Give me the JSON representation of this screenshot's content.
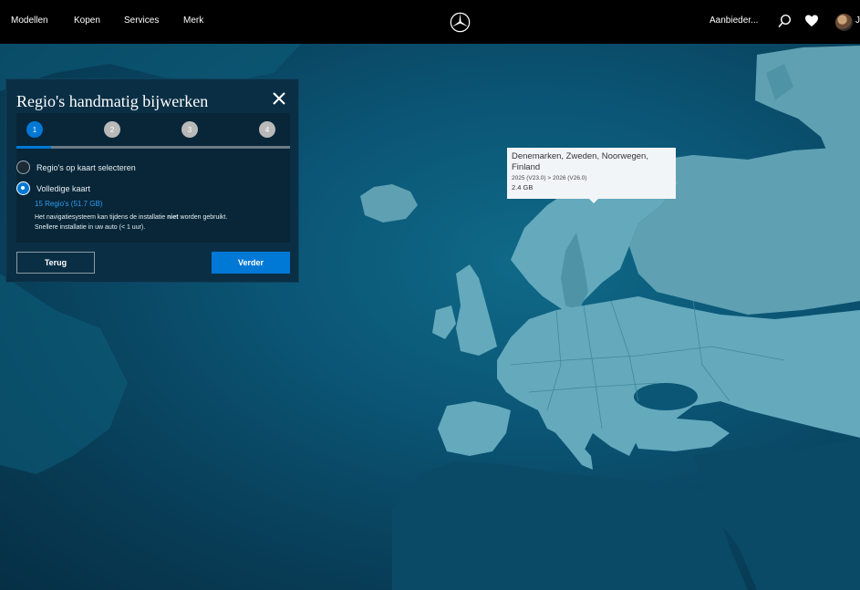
{
  "nav": {
    "items": [
      "Modellen",
      "Kopen",
      "Services",
      "Merk"
    ],
    "offers_label": "Aanbieder...",
    "user_initial": "J"
  },
  "dialog": {
    "title": "Regio's handmatig bijwerken",
    "steps": [
      "1",
      "2",
      "3",
      "4"
    ],
    "active_step": 1,
    "options": [
      {
        "label": "Regio's op kaart selecteren",
        "checked": false
      },
      {
        "label": "Volledige kaart",
        "checked": true
      }
    ],
    "selected_summary": "15 Regio's (51.7 GB)",
    "description_before": "Het navigatiesysteem kan tijdens de installatie ",
    "description_bold": "niet",
    "description_after": " worden gebruikt.",
    "description_line2": "Snellere installatie in uw auto (< 1 uur).",
    "back_label": "Terug",
    "next_label": "Verder"
  },
  "tooltip": {
    "title": "Denemarken, Zweden, Noorwegen, Finland",
    "version": "2025 (V23.0) > 2026 (V26.0)",
    "size": "2.4 GB"
  },
  "colors": {
    "nav_bg": "#000000",
    "accent": "#0078d6",
    "panel_bg": "#0a2f45",
    "land": "#5fa1b3",
    "ocean": "#0b5575"
  },
  "icons": [
    "mercedes-star-icon",
    "search-icon",
    "heart-icon",
    "close-icon"
  ]
}
